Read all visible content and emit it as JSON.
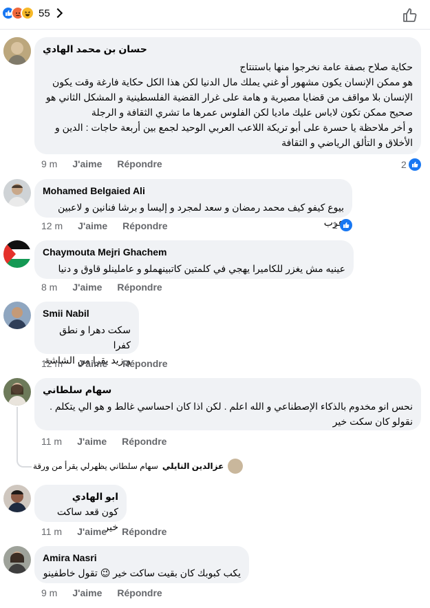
{
  "header": {
    "reaction_count": "55",
    "reaction_icons": [
      "like-icon",
      "angry-icon",
      "haha-icon"
    ]
  },
  "labels": {
    "like": "J'aime",
    "reply": "Répondre"
  },
  "comments": [
    {
      "author": "حسان بن محمد الهادي",
      "text": "حكاية صلاح بصفة عامة نخرجوا منها باستنتاج\nهو ممكن الإنسان يكون مشهور أو غني يملك مال الدنيا لكن هذا الكل حكاية فارغة وقت يكون الإنسان بلا مواقف من قضايا مصيرية و هامة على غرار القضية الفلسطينية و المشكل الثاني هو صحيح ممكن تكون لاباس عليك ماديا لكن الفلوس عمرها ما تشري الثقافة و الرجلة\nو أخر ملاحظة يا حسرة على أبو تريكة اللاعب العربي الوحيد لجمع بين أربعة حاجات : الدين و الأخلاق و التألق الرياضي و الثقافة",
      "time": "9 m",
      "likes": "2"
    },
    {
      "author": "Mohamed Belgaied Ali",
      "text": "بيوع كيفو كيف محمد رمضان و سعد لمجرد و إليسا و برشا فنانين و لاعبين عرب",
      "time": "12 m",
      "likes": "1"
    },
    {
      "author": "Chaymouta Mejri Ghachem",
      "text": "عينيه مش يغزر للكاميرا يهجي في كلمتين كاتبينهملو و عاملينلو قاوق و دنيا",
      "time": "8 m"
    },
    {
      "author": "Smii Nabil",
      "text": "سكت دهرا و نطق كفرا\nو زيد يقرا من الشاشة",
      "time": "12 m"
    },
    {
      "author": "سهام سلطاني",
      "text": "نحس انو مخدوم بالذكاء الإصطناعي و الله اعلم . لكن اذا كان احساسي غالط و هو الي يتكلم .\nنقولو كان سكت خير",
      "time": "11 m",
      "reply": {
        "name": "عزالدين النايلي",
        "text": "سهام سلطاني يظهرلي يقرأ من ورقة"
      }
    },
    {
      "author": "ابو الهادي",
      "text": "كون قعد ساكت خير",
      "time": "11 m"
    },
    {
      "author": "Amira Nasri",
      "text": "يكب كبوبك كان بقيت ساكت خير 😉 تقول خاطفينو",
      "time": "9 m"
    }
  ],
  "colors": {
    "bubble": "#f0f2f5",
    "meta": "#65676b",
    "accent": "#1877f2"
  }
}
